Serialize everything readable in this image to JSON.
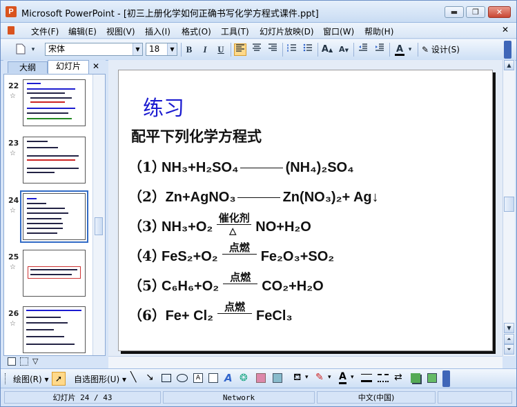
{
  "window": {
    "title": "Microsoft PowerPoint - [初三上册化学如何正确书写化学方程式课件.ppt]",
    "app_icon": "P",
    "minimize": "▬",
    "restore": "❐",
    "close": "✕"
  },
  "menu": [
    "文件(F)",
    "编辑(E)",
    "视图(V)",
    "插入(I)",
    "格式(O)",
    "工具(T)",
    "幻灯片放映(D)",
    "窗口(W)",
    "帮助(H)"
  ],
  "menu_close": "✕",
  "toolbar": {
    "font": "宋体",
    "size": "18",
    "bold": "B",
    "italic": "I",
    "underline": "U",
    "design_label": "设计(S)"
  },
  "panel": {
    "tabs": [
      "大纲",
      "幻灯片"
    ],
    "close": "✕",
    "slides": [
      {
        "num": "22",
        "star": "☆"
      },
      {
        "num": "23",
        "star": "☆"
      },
      {
        "num": "24",
        "star": "☆",
        "selected": true
      },
      {
        "num": "25",
        "star": "☆"
      },
      {
        "num": "26",
        "star": "☆"
      }
    ]
  },
  "slide": {
    "title": "练习",
    "subtitle": "配平下列化学方程式",
    "equations": [
      {
        "num": "（1）",
        "left": "NH₃+H₂SO₄",
        "cond": "",
        "right": "(NH₄)₂SO₄"
      },
      {
        "num": "（2）",
        "left": "Zn+AgNO₃",
        "cond": "",
        "right": "Zn(NO₃)₂+ Ag↓"
      },
      {
        "num": "（3）",
        "left": "NH₃+O₂",
        "cond": "催化剂",
        "right": "NO+H₂O"
      },
      {
        "num": "（4）",
        "left": "FeS₂+O₂",
        "cond": "点燃",
        "right": "Fe₂O₃+SO₂"
      },
      {
        "num": "（5）",
        "left": "C₆H₆+O₂",
        "cond": "点燃",
        "right": "CO₂+H₂O"
      },
      {
        "num": "（6）",
        "left": "Fe+ Cl₂",
        "cond": "点燃",
        "right": "FeCl₃"
      }
    ],
    "delta": "△"
  },
  "drawbar": {
    "draw_label": "绘图(R)",
    "autoshape_label": "自选图形(U)"
  },
  "status": {
    "slide_info": "幻灯片 24 / 43",
    "theme": "Network",
    "language": "中文(中国)"
  }
}
